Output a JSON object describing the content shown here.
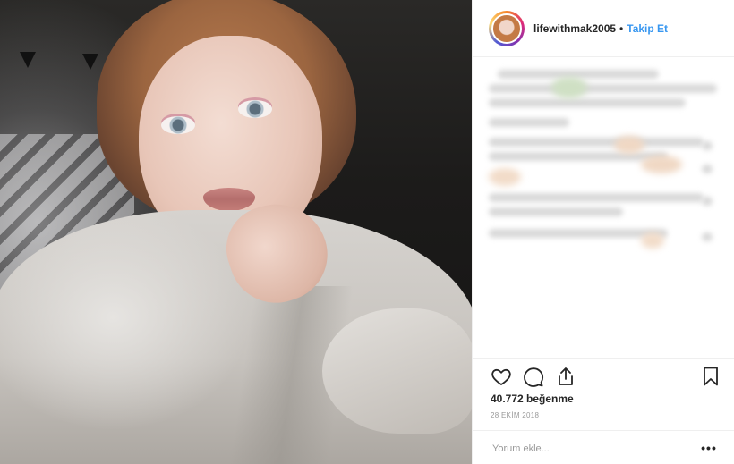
{
  "post": {
    "username": "lifewithmak2005",
    "separator": "•",
    "follow_label": "Takip Et",
    "likes_text": "40.772 beğenme",
    "date_text": "28 EKİM 2018",
    "comment_placeholder": "Yorum ekle...",
    "more_label": "•••"
  },
  "icons": {
    "like": "heart-icon",
    "comment": "comment-bubble-icon",
    "share": "share-icon",
    "save": "bookmark-icon"
  },
  "colors": {
    "follow": "#3897f0",
    "text": "#262626",
    "muted": "#999999",
    "divider": "#efefef"
  }
}
